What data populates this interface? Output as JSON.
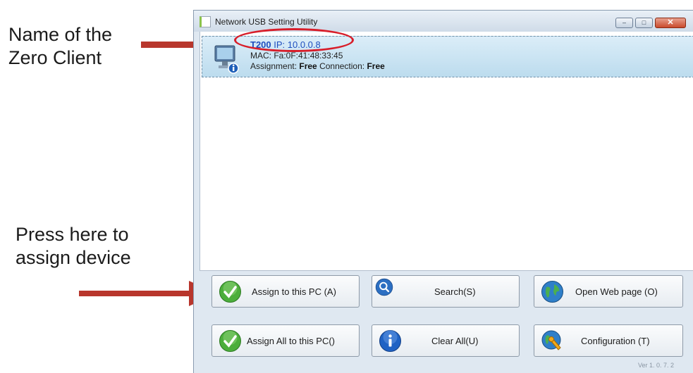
{
  "annotations": {
    "name_line1": "Name of the",
    "name_line2": "Zero Client",
    "press_line1": "Press here to",
    "press_line2": "assign device"
  },
  "window": {
    "title": "Network USB Setting Utility",
    "controls": {
      "minimize": "–",
      "maximize": "□",
      "close": "✕"
    }
  },
  "device": {
    "name": "T200",
    "ip_label": " IP: ",
    "ip": "10.0.0.8",
    "mac_text": "MAC: Fa:0F:41:48:33:45",
    "assignment_label": "Assignment: ",
    "assignment_value": "Free",
    "connection_label": " Connection: ",
    "connection_value": "Free",
    "icon": "monitor-info-icon"
  },
  "buttons": {
    "assign": {
      "label": "Assign to this PC (A)",
      "icon": "checkmark-icon"
    },
    "search": {
      "label": "Search(S)",
      "icon": "magnifier-icon"
    },
    "web": {
      "label": "Open Web page (O)",
      "icon": "globe-icon"
    },
    "assign_all": {
      "label": "Assign All to this PC()",
      "icon": "checkmark-icon"
    },
    "clear": {
      "label": "Clear All(U)",
      "icon": "info-icon"
    },
    "config": {
      "label": "Configuration (T)",
      "icon": "wrench-globe-icon"
    }
  },
  "version": "Ver 1. 0. 7. 2",
  "colors": {
    "highlight_red": "#d81e2a",
    "selection_blue": "#bcdcee",
    "arrow_red": "#b8362c"
  }
}
